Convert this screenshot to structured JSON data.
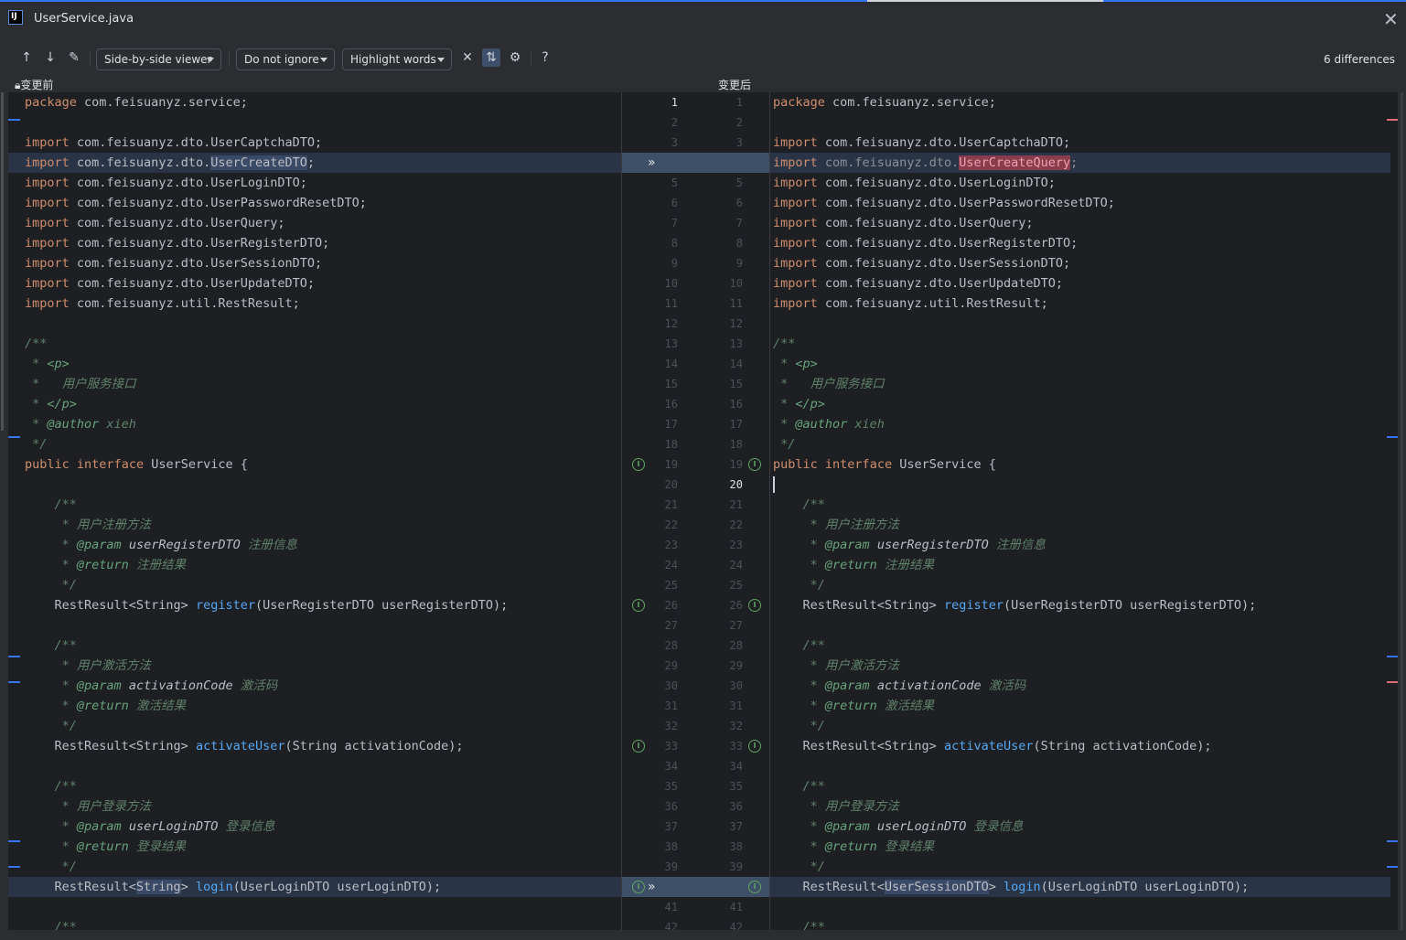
{
  "window": {
    "title": "UserService.java",
    "app_icon": "IJ"
  },
  "toolbar": {
    "viewer": "Side-by-side viewer",
    "ignore": "Do not ignore",
    "highlight": "Highlight words",
    "help": "?",
    "differences": "6 differences"
  },
  "labels": {
    "before": "变更前",
    "after": "变更后"
  },
  "left_lines": [
    "package com.feisuanyz.service;",
    "",
    "import com.feisuanyz.dto.UserCaptchaDTO;",
    "import com.feisuanyz.dto.UserCreateDTO;",
    "import com.feisuanyz.dto.UserLoginDTO;",
    "import com.feisuanyz.dto.UserPasswordResetDTO;",
    "import com.feisuanyz.dto.UserQuery;",
    "import com.feisuanyz.dto.UserRegisterDTO;",
    "import com.feisuanyz.dto.UserSessionDTO;",
    "import com.feisuanyz.dto.UserUpdateDTO;",
    "import com.feisuanyz.util.RestResult;",
    "",
    "/**",
    " * <p>",
    " *   用户服务接口",
    " * </p>",
    " * @author xieh",
    " */",
    "public interface UserService {",
    "",
    "    /**",
    "     * 用户注册方法",
    "     * @param userRegisterDTO 注册信息",
    "     * @return 注册结果",
    "     */",
    "    RestResult<String> register(UserRegisterDTO userRegisterDTO);",
    "",
    "    /**",
    "     * 用户激活方法",
    "     * @param activationCode 激活码",
    "     * @return 激活结果",
    "     */",
    "    RestResult<String> activateUser(String activationCode);",
    "",
    "    /**",
    "     * 用户登录方法",
    "     * @param userLoginDTO 登录信息",
    "     * @return 登录结果",
    "     */",
    "    RestResult<String> login(UserLoginDTO userLoginDTO);",
    "",
    "    /**"
  ],
  "right_lines": [
    "package com.feisuanyz.service;",
    "",
    "import com.feisuanyz.dto.UserCaptchaDTO;",
    "import com.feisuanyz.dto.UserCreateQuery;",
    "import com.feisuanyz.dto.UserLoginDTO;",
    "import com.feisuanyz.dto.UserPasswordResetDTO;",
    "import com.feisuanyz.dto.UserQuery;",
    "import com.feisuanyz.dto.UserRegisterDTO;",
    "import com.feisuanyz.dto.UserSessionDTO;",
    "import com.feisuanyz.dto.UserUpdateDTO;",
    "import com.feisuanyz.util.RestResult;",
    "",
    "/**",
    " * <p>",
    " *   用户服务接口",
    " * </p>",
    " * @author xieh",
    " */",
    "public interface UserService {",
    "",
    "    /**",
    "     * 用户注册方法",
    "     * @param userRegisterDTO 注册信息",
    "     * @return 注册结果",
    "     */",
    "    RestResult<String> register(UserRegisterDTO userRegisterDTO);",
    "",
    "    /**",
    "     * 用户激活方法",
    "     * @param activationCode 激活码",
    "     * @return 激活结果",
    "     */",
    "    RestResult<String> activateUser(String activationCode);",
    "",
    "    /**",
    "     * 用户登录方法",
    "     * @param userLoginDTO 登录信息",
    "     * @return 登录结果",
    "     */",
    "    RestResult<UserSessionDTO> login(UserLoginDTO userLoginDTO);",
    "",
    "    /**"
  ],
  "left_numbers": [
    "1",
    "2",
    "3",
    "",
    "5",
    "6",
    "7",
    "8",
    "9",
    "10",
    "11",
    "12",
    "13",
    "14",
    "15",
    "16",
    "17",
    "18",
    "19",
    "20",
    "21",
    "22",
    "23",
    "24",
    "25",
    "26",
    "27",
    "28",
    "29",
    "30",
    "31",
    "32",
    "33",
    "34",
    "35",
    "36",
    "37",
    "38",
    "39",
    "",
    "41",
    "42"
  ],
  "right_numbers": [
    "1",
    "2",
    "3",
    "",
    "5",
    "6",
    "7",
    "8",
    "9",
    "10",
    "11",
    "12",
    "13",
    "14",
    "15",
    "16",
    "17",
    "18",
    "19",
    "20",
    "21",
    "22",
    "23",
    "24",
    "25",
    "26",
    "27",
    "28",
    "29",
    "30",
    "31",
    "32",
    "33",
    "34",
    "35",
    "36",
    "37",
    "38",
    "39",
    "",
    "41",
    "42"
  ],
  "current_line": "20",
  "colors": {
    "keyword": "#cf8e6d",
    "method": "#56a8f5",
    "doc": "#5f826b",
    "changed_bg": "#293547",
    "word_diff": "#3a4a66"
  }
}
